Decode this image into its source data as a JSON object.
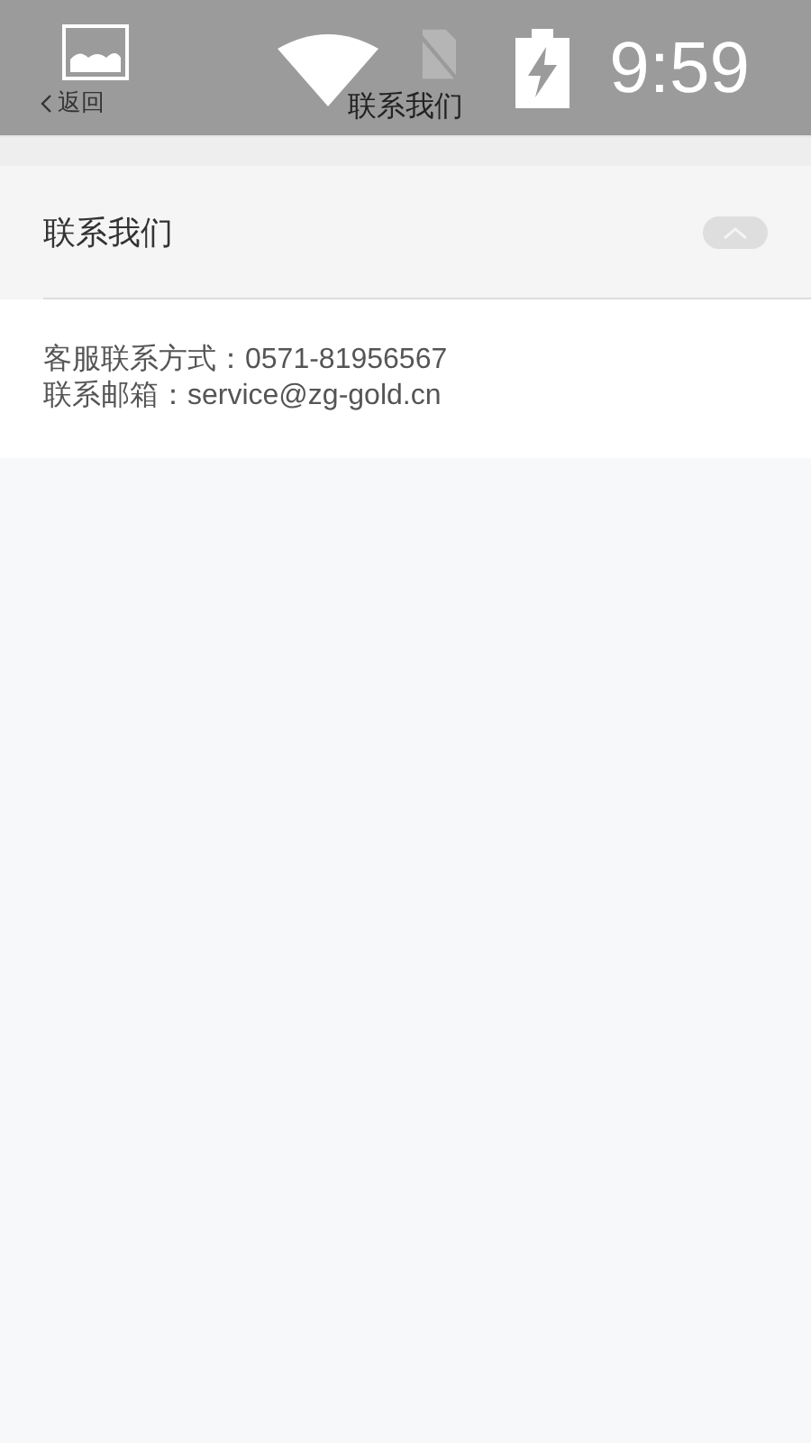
{
  "status_bar": {
    "time": "9:59"
  },
  "nav_bar": {
    "back": "返回",
    "title": "联系我们"
  },
  "section": {
    "title": "联系我们",
    "expanded": true,
    "lines": [
      "客服联系方式：0571-81956567",
      "联系邮箱：service@zg-gold.cn"
    ]
  }
}
